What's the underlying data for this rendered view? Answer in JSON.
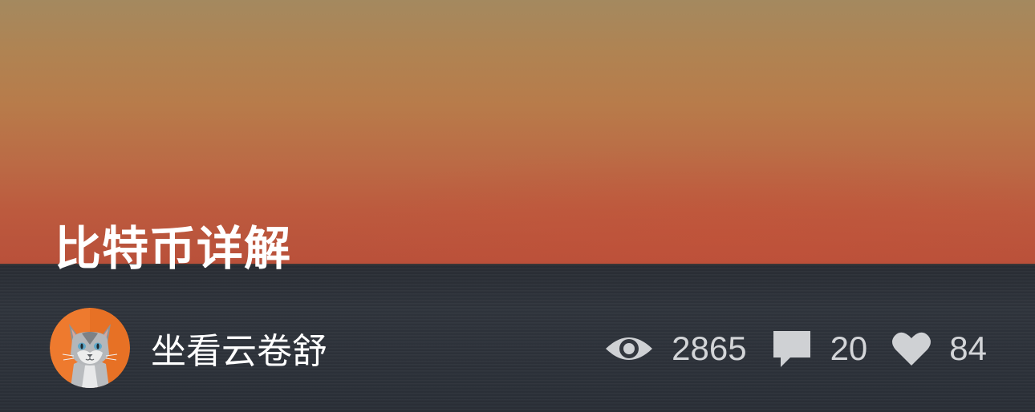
{
  "post": {
    "title": "比特币详解",
    "author": {
      "name": "坐看云卷舒",
      "avatar_icon": "cat-avatar-icon"
    },
    "stats": {
      "views": "2865",
      "comments": "20",
      "likes": "84"
    },
    "icons": {
      "views": "eye-icon",
      "comments": "comment-icon",
      "likes": "heart-icon"
    }
  },
  "colors": {
    "title": "#ffffff",
    "stats_text": "#d3d5d8",
    "avatar_bg": "#ee7a2e"
  }
}
